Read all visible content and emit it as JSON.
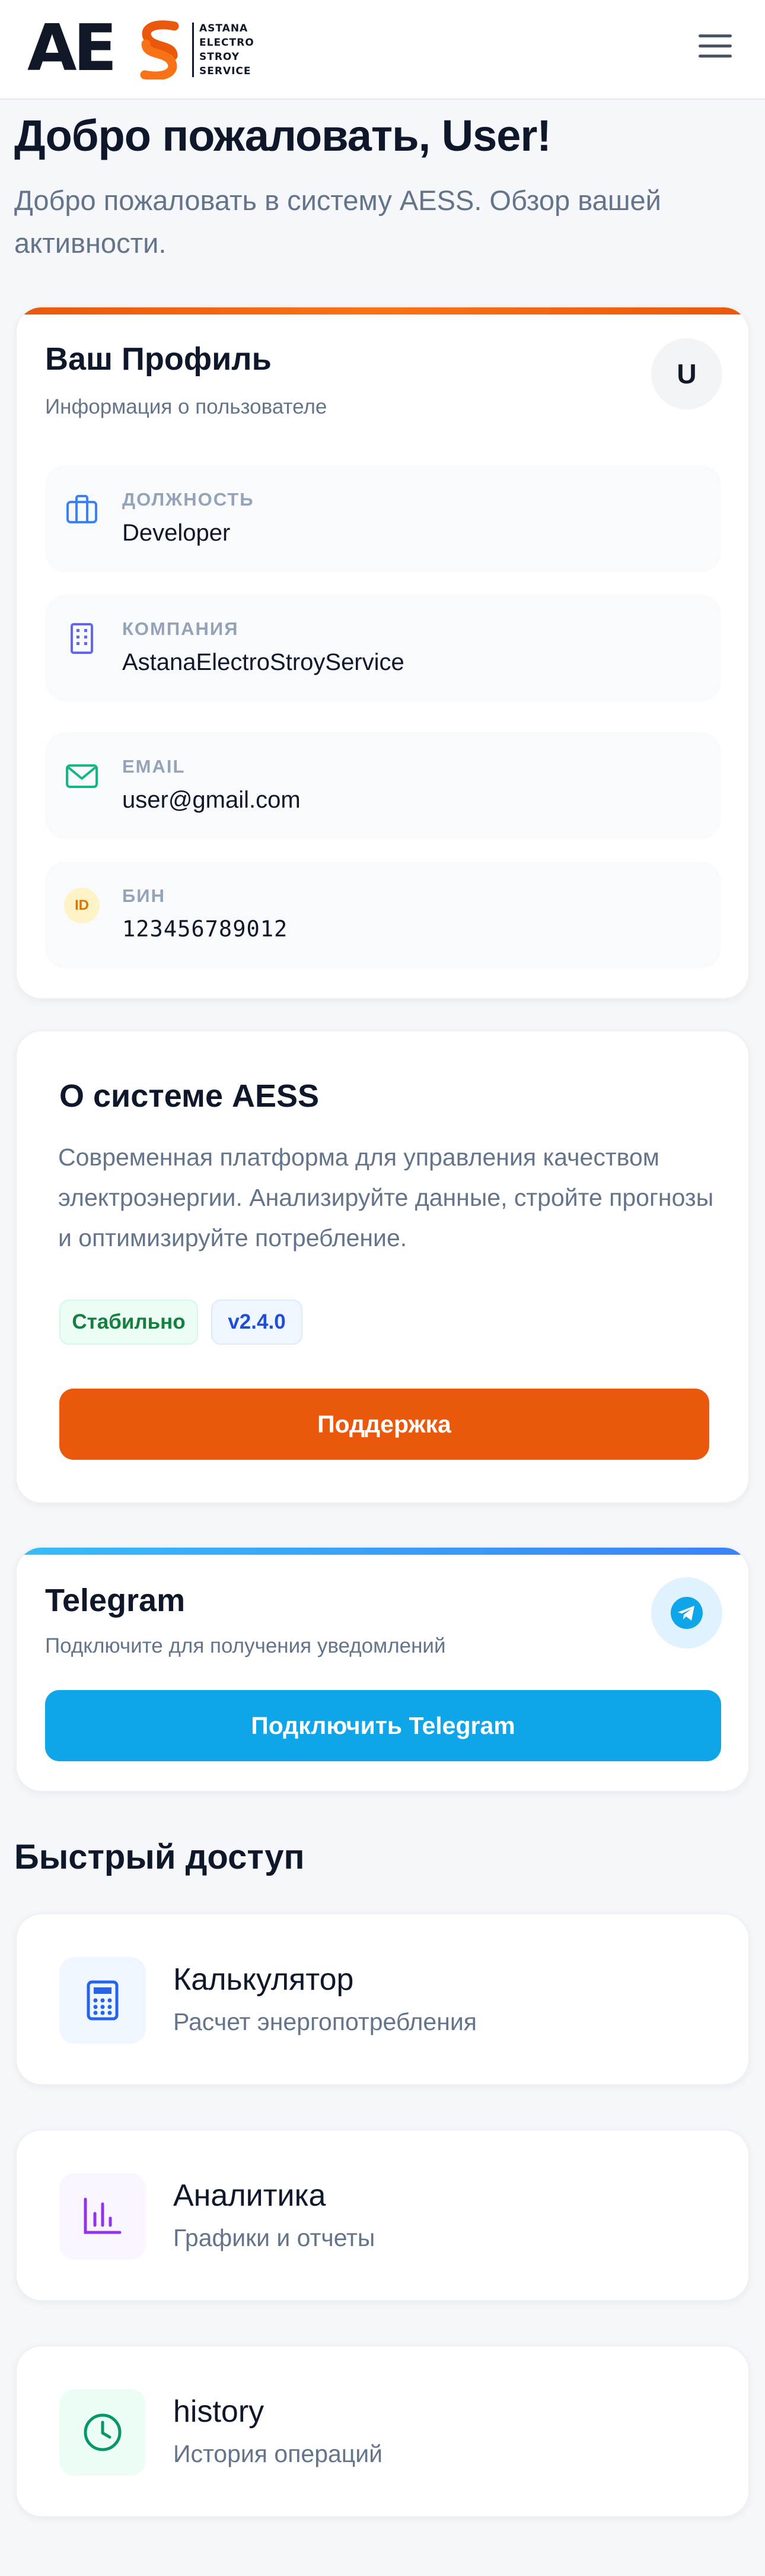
{
  "header": {
    "logo_mark": "AE",
    "logo_lines": [
      "ASTANA",
      "ELECTRO",
      "STROY",
      "SERVICE"
    ],
    "menu_icon": "hamburger-menu-icon"
  },
  "welcome": {
    "title": "Добро пожаловать, User!",
    "subtitle": "Добро пожаловать в систему AESS. Обзор вашей активности."
  },
  "profile": {
    "title": "Ваш Профиль",
    "subtitle": "Информация о пользователе",
    "avatar_initial": "U",
    "fields": [
      {
        "label": "ДОЛЖНОСТЬ",
        "value": "Developer",
        "icon": "briefcase-icon",
        "color": "#3b82f6"
      },
      {
        "label": "КОМПАНИЯ",
        "value": "AstanaElectroStroyService",
        "icon": "building-icon",
        "color": "#6366f1"
      },
      {
        "label": "EMAIL",
        "value": "user@gmail.com",
        "icon": "mail-icon",
        "color": "#10b981"
      },
      {
        "label": "БИН",
        "value": "123456789012",
        "icon": "id-badge-icon",
        "icon_text": "ID",
        "color": "#f59e0b"
      }
    ]
  },
  "about": {
    "title": "О системе AESS",
    "description": "Современная платформа для управления качеством электроэнергии. Анализируйте данные, стройте прогнозы и оптимизируйте потребление.",
    "badge_status": "Стабильно",
    "badge_version": "v2.4.0",
    "support_label": "Поддержка"
  },
  "telegram": {
    "title": "Telegram",
    "subtitle": "Подключите для получения уведомлений",
    "connect_label": "Подключить Telegram"
  },
  "quick_access": {
    "title": "Быстрый доступ",
    "items": [
      {
        "title": "Калькулятор",
        "subtitle": "Расчет энергопотребления",
        "icon": "calculator-icon",
        "color": "#2563eb",
        "bg": "#eff6ff"
      },
      {
        "title": "Аналитика",
        "subtitle": "Графики и отчеты",
        "icon": "bar-chart-icon",
        "color": "#9333ea",
        "bg": "#faf5ff"
      },
      {
        "title": "history",
        "subtitle": "История операций",
        "icon": "clock-icon",
        "color": "#059669",
        "bg": "#ecfdf5"
      }
    ]
  },
  "colors": {
    "accent": "#ea580c",
    "telegram": "#0ea5e9",
    "text": "#0f172a",
    "muted": "#64748b"
  }
}
